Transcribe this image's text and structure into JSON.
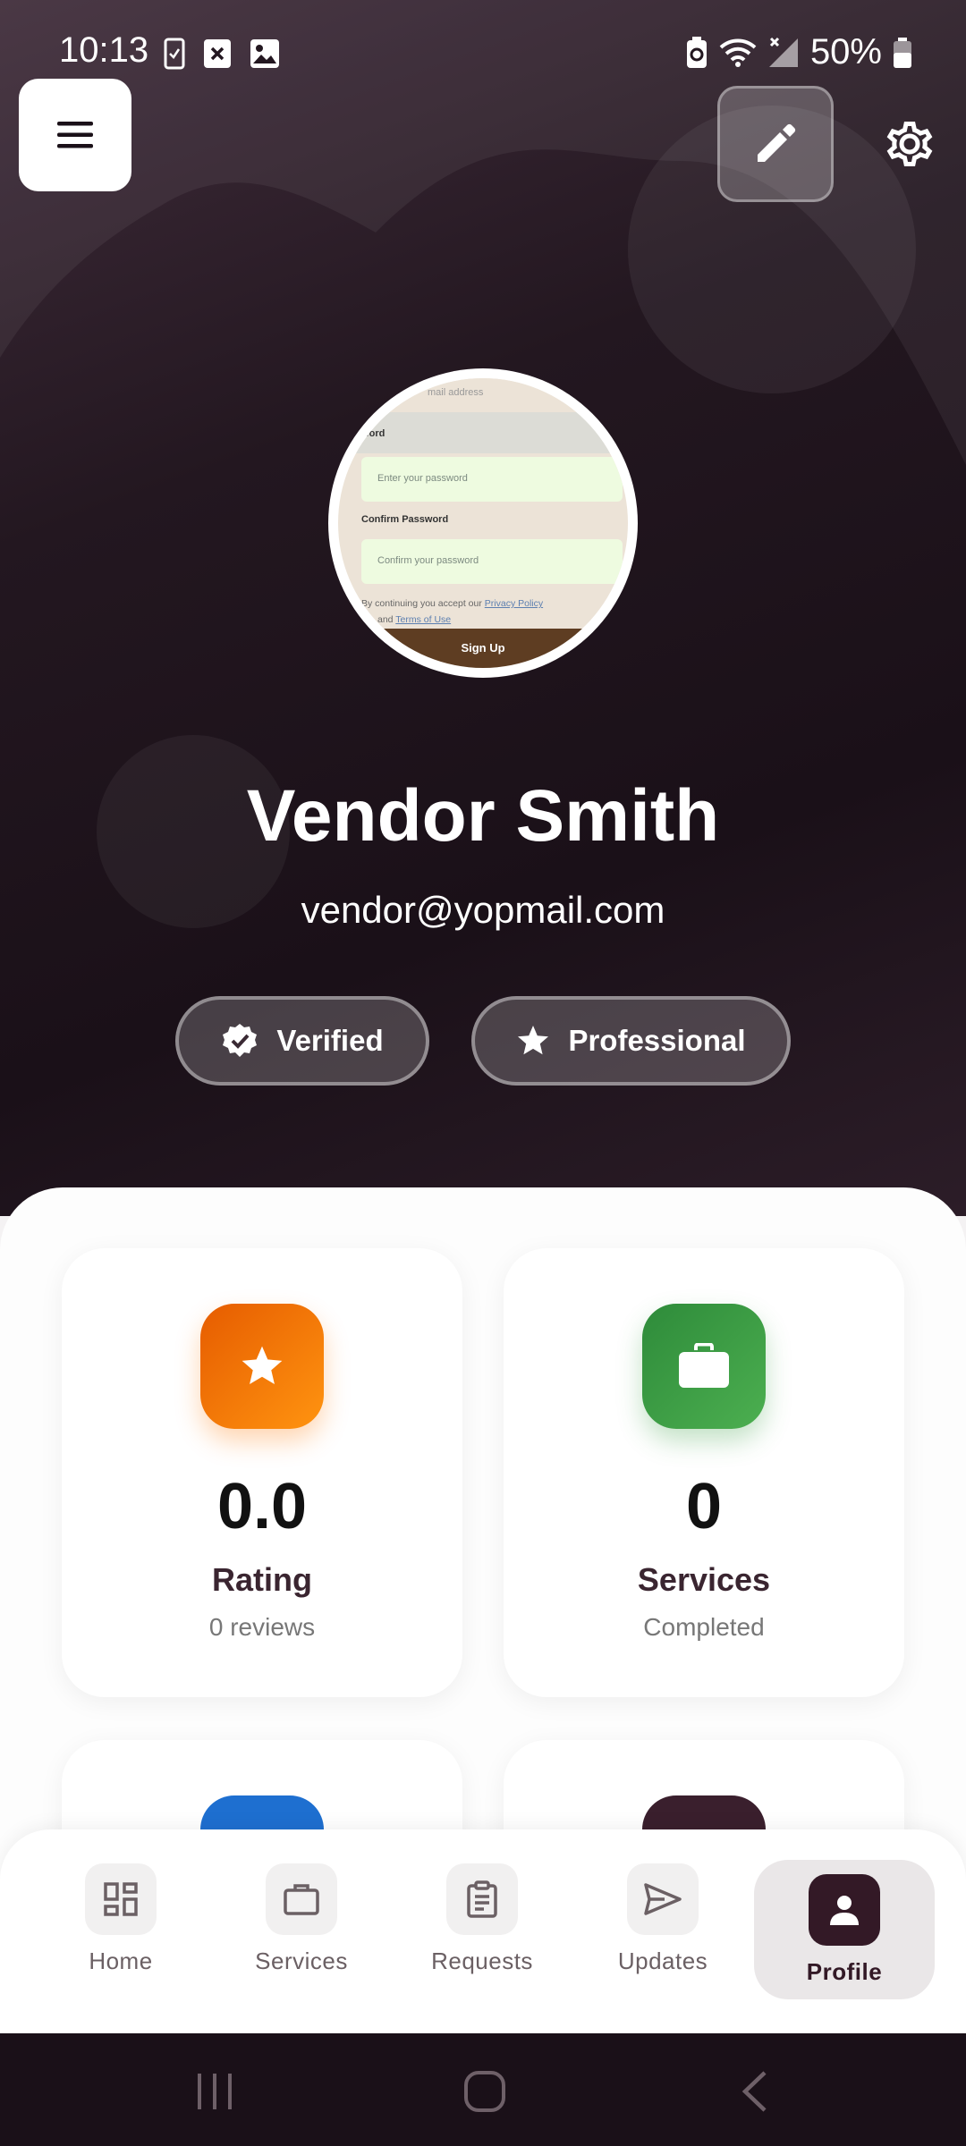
{
  "status_bar": {
    "time": "10:13",
    "battery": "50%"
  },
  "header": {
    "menu_icon": "hamburger-menu-icon",
    "edit_icon": "pencil-icon",
    "settings_icon": "gear-icon"
  },
  "avatar_preview": {
    "email_hint": "mail address",
    "password_label": "sword",
    "password_placeholder": "Enter your password",
    "confirm_label": "Confirm Password",
    "confirm_placeholder": "Confirm your password",
    "terms_prefix": "By continuing you accept our",
    "privacy_link": "Privacy Policy",
    "terms_and": "and",
    "terms_link": "Terms of Use",
    "signup": "Sign Up"
  },
  "profile": {
    "name": "Vendor Smith",
    "email": "vendor@yopmail.com",
    "badges": [
      {
        "label": "Verified",
        "icon": "verified-badge-icon"
      },
      {
        "label": "Professional",
        "icon": "star-icon"
      }
    ]
  },
  "stats": [
    {
      "value": "0.0",
      "label": "Rating",
      "sub": "0 reviews",
      "icon": "star-icon",
      "color": "#ff8a00"
    },
    {
      "value": "0",
      "label": "Services",
      "sub": "Completed",
      "icon": "briefcase-icon",
      "color": "#43a047"
    }
  ],
  "bottom_nav": {
    "items": [
      {
        "label": "Home",
        "icon": "dashboard-icon"
      },
      {
        "label": "Services",
        "icon": "briefcase-icon"
      },
      {
        "label": "Requests",
        "icon": "clipboard-icon"
      },
      {
        "label": "Updates",
        "icon": "send-icon"
      },
      {
        "label": "Profile",
        "icon": "person-icon"
      }
    ],
    "active": "Profile"
  },
  "colors": {
    "accent": "#331926",
    "header_bg": "#231720"
  }
}
